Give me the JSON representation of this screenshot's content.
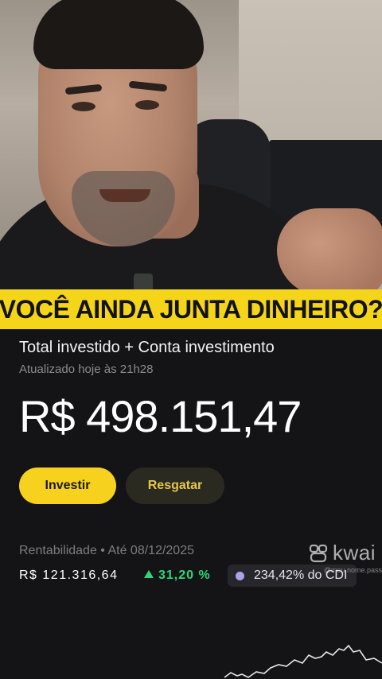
{
  "caption": "VOCÊ AINDA JUNTA DINHEIRO?",
  "panel": {
    "title": "Total investido + Conta investimento",
    "updated": "Atualizado hoje às 21h28",
    "amount": "R$ 498.151,47",
    "buttons": {
      "invest": "Investir",
      "redeem": "Resgatar"
    },
    "rentabilidade": {
      "label": "Rentabilidade • Até 08/12/2025",
      "value": "R$ 121.316,64",
      "percent": "31,20 %",
      "cdi": "234,42% do CDI"
    }
  },
  "watermark": {
    "brand": "kwai",
    "sub": "@meu.nome.pass"
  },
  "colors": {
    "accent": "#f6d21f",
    "positive": "#2bd77a",
    "cdi_dot": "#a9a4e6",
    "background": "#141416"
  },
  "icons": {
    "up": "triangle-up-icon",
    "kwai": "kwai-logo-icon"
  }
}
